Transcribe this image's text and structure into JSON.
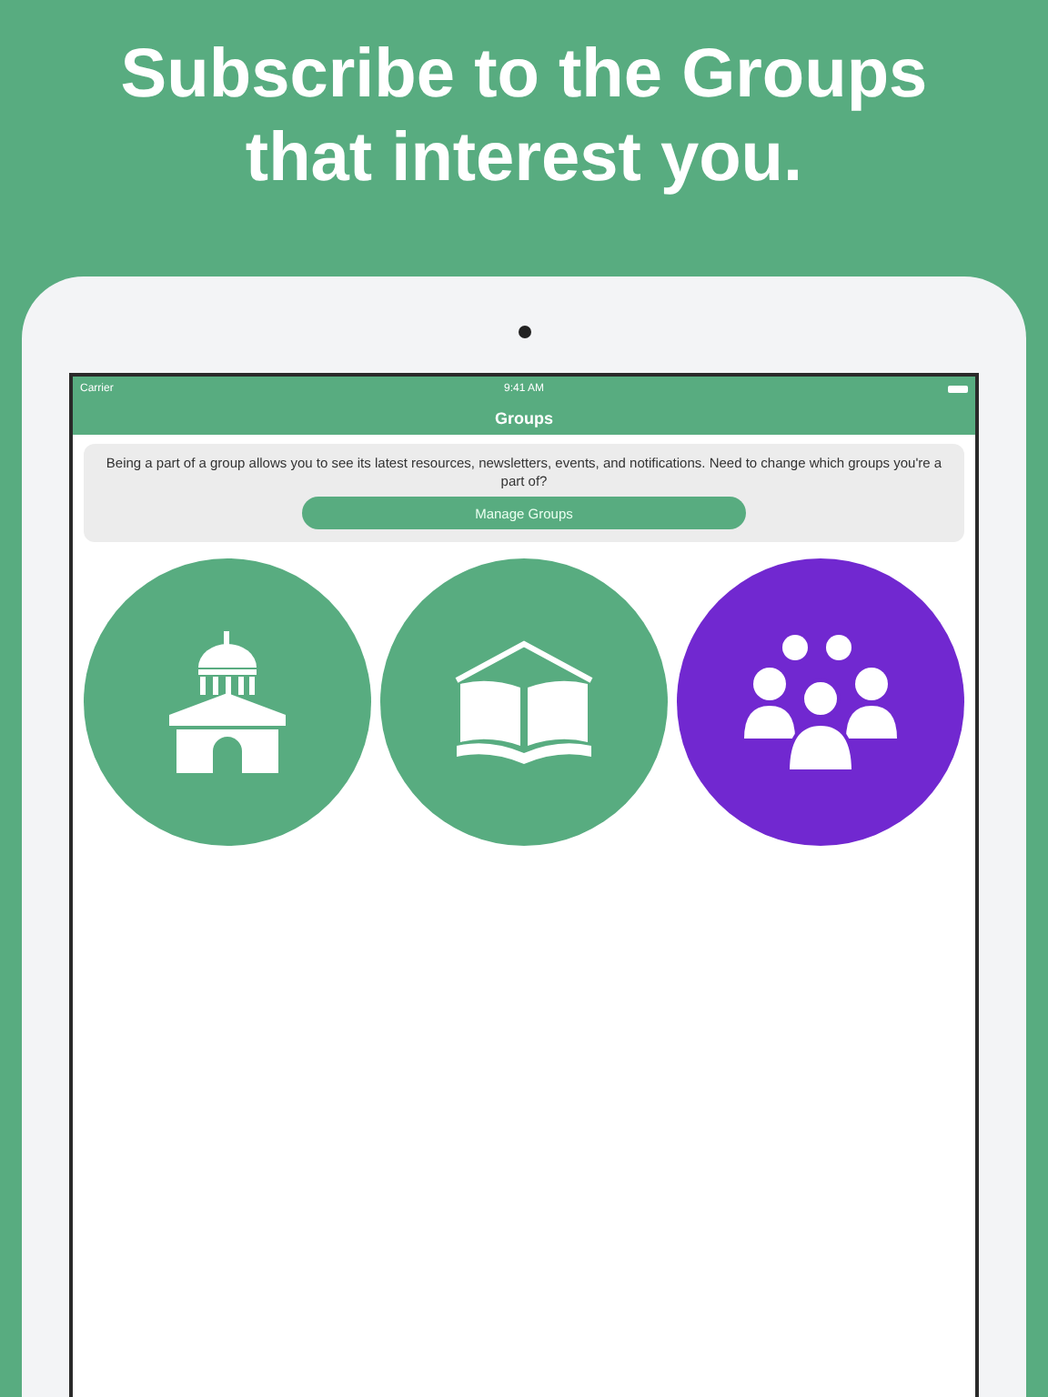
{
  "headline": "Subscribe to the Groups that interest you.",
  "status_bar": {
    "carrier": "Carrier",
    "time": "9:41 AM"
  },
  "nav": {
    "title": "Groups"
  },
  "banner": {
    "text": "Being a part of a group allows you to see its latest resources, newsletters, events, and notifications. Need to change which groups you're a part of?",
    "button": "Manage Groups"
  },
  "groups": [
    {
      "kind": "building",
      "color": "#58ac80"
    },
    {
      "kind": "book",
      "color": "#58ac80"
    },
    {
      "kind": "people",
      "color": "#7128d0"
    }
  ]
}
